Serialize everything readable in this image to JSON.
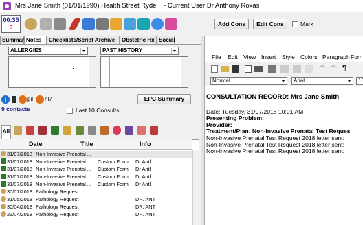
{
  "window": {
    "title": "Mrs Jane Smith (01/01/1990) Health Street Ryde",
    "current_user": "- Current User Dr Anthony Roxas"
  },
  "toolbar": {
    "timer": "00:35",
    "timer_count": "0",
    "add_cons_label": "Add Cons",
    "edit_cons_label": "Edit Cons",
    "mark_label": "Mark"
  },
  "tabs": [
    {
      "label": "Summary"
    },
    {
      "label": "Notes"
    },
    {
      "label": "Checklists/Script Archive"
    },
    {
      "label": "Obstetric Hx"
    },
    {
      "label": "Social"
    }
  ],
  "left": {
    "allergies_label": "ALLERGIES",
    "past_history_label": "PAST HISTORY",
    "pill_label_1": "pil",
    "pill_label_2": "hl7",
    "epc_button": "EPC Summary",
    "contacts_count": "9 contacts",
    "last10_label": "Last 10 Consults",
    "all_tab": "All"
  },
  "table": {
    "headers": {
      "date": "Date",
      "title": "Title",
      "info": "Info"
    },
    "rows": [
      {
        "icon": "doctor",
        "date": "31/07/2018",
        "title": "Non-Invasive Prenatal ...",
        "info": "",
        "extra": ""
      },
      {
        "icon": "pen",
        "date": "31/07/2018",
        "title": "Non-Invasive Prenatal ...",
        "info": "Custom Form",
        "extra": "Dr Antl"
      },
      {
        "icon": "pen",
        "date": "31/07/2018",
        "title": "Non-Invasive Prenatal ...",
        "info": "Custom Form",
        "extra": "Dr Antl"
      },
      {
        "icon": "pen",
        "date": "31/07/2018",
        "title": "Non-Invasive Prenatal ...",
        "info": "Custom Form",
        "extra": "Dr Antl"
      },
      {
        "icon": "pen",
        "date": "31/07/2018",
        "title": "Non-Invasive Prenatal ...",
        "info": "Custom Form",
        "extra": "Dr Antl"
      },
      {
        "icon": "doctor",
        "date": "30/07/2018",
        "title": "Pathology Request",
        "info": "",
        "extra": ""
      },
      {
        "icon": "doctor",
        "date": "31/05/2018",
        "title": "Pathology Request",
        "info": "",
        "extra": "DR. ANT"
      },
      {
        "icon": "doctor",
        "date": "30/04/2018",
        "title": "Pathology Request",
        "info": "",
        "extra": "DR. ANT"
      },
      {
        "icon": "doctor",
        "date": "23/04/2018",
        "title": "Pathology Request",
        "info": "",
        "extra": "DR. ANT"
      }
    ]
  },
  "editor": {
    "menu": [
      "File",
      "Edit",
      "View",
      "Insert",
      "Style",
      "Colors",
      "Paragraph",
      "Forr"
    ],
    "style_value": "Normal",
    "font_value": "Arial",
    "size_value": "10",
    "heading": "CONSULTATION RECORD: Mrs Jane Smith",
    "lines": [
      "Date: Tuesday, 31/07/2018  10:01 AM",
      "Presenting Problem:",
      "Provider:",
      "Treatment/Plan:  Non-Invasive Prenatal Test Reques",
      "Non-Invasive Prenatal Test Request 2018 letter sent:",
      "Non-Invasive Prenatal Test Request 2018 letter sent:",
      "Non-Invasive Prenatal Test Request 2018 letter sent:"
    ]
  },
  "colors": {
    "accent": "#9b3fb5",
    "timer_blue": "#1a1a8c",
    "timer_red": "#d00000",
    "contacts_blue": "#1a1a8c"
  }
}
